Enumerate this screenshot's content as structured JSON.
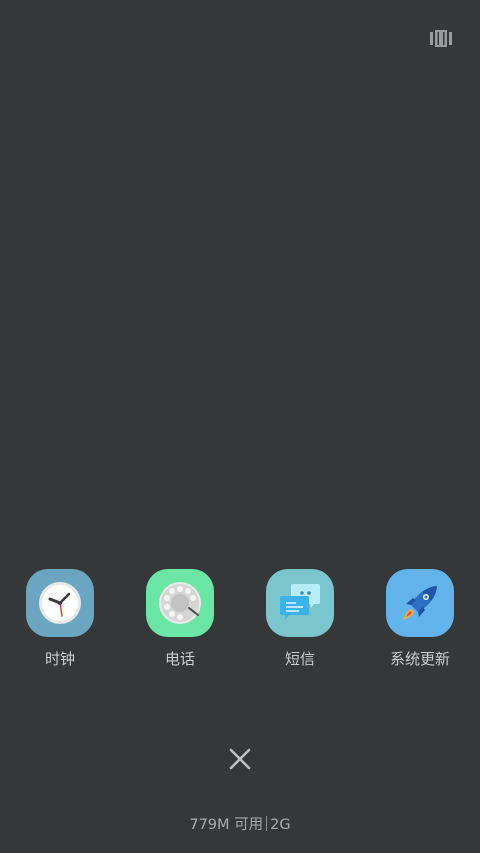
{
  "header": {
    "view_toggle_icon": "card-view-icon"
  },
  "apps": [
    {
      "label": "时钟",
      "icon": "clock-icon",
      "color": "#6aa6c0"
    },
    {
      "label": "电话",
      "icon": "rotary-phone-icon",
      "color": "#6ce6a4"
    },
    {
      "label": "短信",
      "icon": "message-bubbles-icon",
      "color": "#7ac6cc"
    },
    {
      "label": "系统更新",
      "icon": "rocket-icon",
      "color": "#63b4ec"
    }
  ],
  "close": {
    "icon": "close-icon"
  },
  "memory": {
    "available": "779M 可用",
    "total": "2G"
  },
  "colors": {
    "background": "#343838",
    "label_text": "#c9cccc",
    "memory_text": "#a9acac"
  }
}
